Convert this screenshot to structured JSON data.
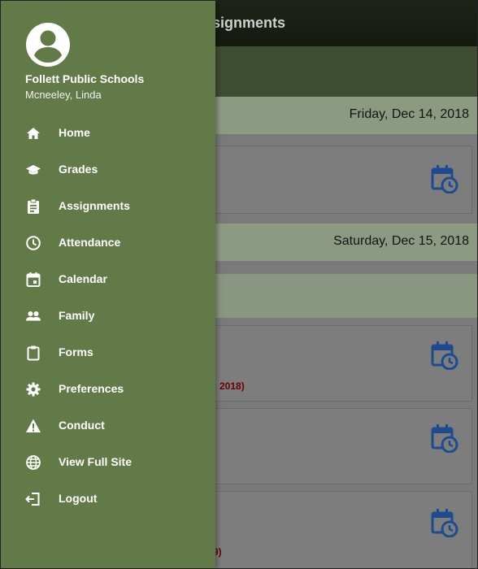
{
  "background": {
    "header_title": "ssignments",
    "filter_caret": "⌄",
    "dates": [
      "Friday, Dec 14, 2018",
      "Saturday, Dec 15, 2018"
    ],
    "red_snippets": [
      "2018)",
      ")",
      "9)"
    ]
  },
  "drawer": {
    "org_name": "Follett Public Schools",
    "user_name": "Mcneeley, Linda",
    "items": [
      {
        "label": "Home",
        "icon": "home-icon"
      },
      {
        "label": "Grades",
        "icon": "graduation-cap-icon"
      },
      {
        "label": "Assignments",
        "icon": "clipboard-list-icon"
      },
      {
        "label": "Attendance",
        "icon": "clock-icon"
      },
      {
        "label": "Calendar",
        "icon": "calendar-icon"
      },
      {
        "label": "Family",
        "icon": "people-icon"
      },
      {
        "label": "Forms",
        "icon": "clipboard-icon"
      },
      {
        "label": "Preferences",
        "icon": "gear-icon"
      },
      {
        "label": "Conduct",
        "icon": "warning-icon"
      },
      {
        "label": "View Full Site",
        "icon": "globe-icon"
      },
      {
        "label": "Logout",
        "icon": "logout-icon"
      }
    ]
  },
  "colors": {
    "drawer_bg": "#627a48",
    "header_bg": "#1a2015",
    "icon_blue": "#1e4b8f",
    "overdue_red": "#6b0000"
  }
}
